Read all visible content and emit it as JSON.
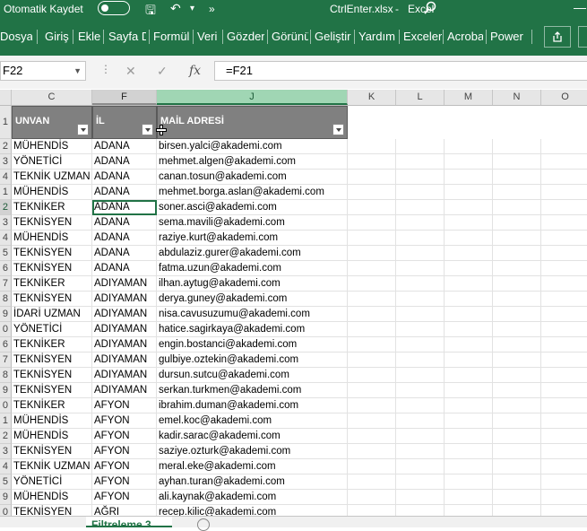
{
  "titlebar": {
    "autosave_label": "Otomatik Kaydet",
    "filename": "CtrlEnter.xlsx",
    "separator": "-",
    "app": "Excel",
    "more": "»"
  },
  "ribbon": {
    "tabs": [
      "Dosya",
      "Giriş",
      "Ekle",
      "Sayfa D",
      "Formül",
      "Veri",
      "Gözder",
      "Görünü",
      "Geliştir",
      "Yardım",
      "Exceler",
      "Acroba",
      "Power"
    ]
  },
  "formula_bar": {
    "name_box": "F22",
    "formula": "=F21",
    "fx": "fx"
  },
  "columns": [
    {
      "label": "C"
    },
    {
      "label": "F"
    },
    {
      "label": "J"
    },
    {
      "label": "K"
    },
    {
      "label": "L"
    },
    {
      "label": "M"
    },
    {
      "label": "N"
    },
    {
      "label": "O"
    }
  ],
  "headers": {
    "row_num": "1",
    "unvan": "UNVAN",
    "il": "İL",
    "mail": "MAİL ADRESİ"
  },
  "rows": [
    {
      "n": "2",
      "unvan": "MÜHENDİS",
      "il": "ADANA",
      "mail": "birsen.yalci@akademi.com"
    },
    {
      "n": "3",
      "unvan": "YÖNETİCİ",
      "il": "ADANA",
      "mail": "mehmet.algen@akademi.com"
    },
    {
      "n": "4",
      "unvan": "TEKNİK UZMAN",
      "il": "ADANA",
      "mail": "canan.tosun@akademi.com"
    },
    {
      "n": "1",
      "unvan": "MÜHENDİS",
      "il": "ADANA",
      "mail": "mehmet.borga.aslan@akademi.com"
    },
    {
      "n": "2",
      "unvan": "TEKNİKER",
      "il": "ADANA",
      "mail": "soner.asci@akademi.com"
    },
    {
      "n": "3",
      "unvan": "TEKNİSYEN",
      "il": "ADANA",
      "mail": "sema.mavili@akademi.com"
    },
    {
      "n": "4",
      "unvan": "MÜHENDİS",
      "il": "ADANA",
      "mail": "raziye.kurt@akademi.com"
    },
    {
      "n": "5",
      "unvan": "TEKNİSYEN",
      "il": "ADANA",
      "mail": "abdulaziz.gurer@akademi.com"
    },
    {
      "n": "6",
      "unvan": "TEKNİSYEN",
      "il": "ADANA",
      "mail": "fatma.uzun@akademi.com"
    },
    {
      "n": "7",
      "unvan": "TEKNİKER",
      "il": "ADIYAMAN",
      "mail": "ilhan.aytug@akademi.com"
    },
    {
      "n": "8",
      "unvan": "TEKNİSYEN",
      "il": "ADIYAMAN",
      "mail": "derya.guney@akademi.com"
    },
    {
      "n": "9",
      "unvan": "İDARİ UZMAN",
      "il": "ADIYAMAN",
      "mail": "nisa.cavusuzumu@akademi.com"
    },
    {
      "n": "0",
      "unvan": "YÖNETİCİ",
      "il": "ADIYAMAN",
      "mail": "hatice.sagirkaya@akademi.com"
    },
    {
      "n": "6",
      "unvan": "TEKNİKER",
      "il": "ADIYAMAN",
      "mail": "engin.bostanci@akademi.com"
    },
    {
      "n": "7",
      "unvan": "TEKNİSYEN",
      "il": "ADIYAMAN",
      "mail": "gulbiye.oztekin@akademi.com"
    },
    {
      "n": "8",
      "unvan": "TEKNİSYEN",
      "il": "ADIYAMAN",
      "mail": "dursun.sutcu@akademi.com"
    },
    {
      "n": "9",
      "unvan": "TEKNİSYEN",
      "il": "ADIYAMAN",
      "mail": "serkan.turkmen@akademi.com"
    },
    {
      "n": "0",
      "unvan": "TEKNİKER",
      "il": "AFYON",
      "mail": "ibrahim.duman@akademi.com"
    },
    {
      "n": "1",
      "unvan": "MÜHENDİS",
      "il": "AFYON",
      "mail": "emel.koc@akademi.com"
    },
    {
      "n": "2",
      "unvan": "MÜHENDİS",
      "il": "AFYON",
      "mail": "kadir.sarac@akademi.com"
    },
    {
      "n": "3",
      "unvan": "TEKNİSYEN",
      "il": "AFYON",
      "mail": "saziye.ozturk@akademi.com"
    },
    {
      "n": "4",
      "unvan": "TEKNİK UZMAN",
      "il": "AFYON",
      "mail": "meral.eke@akademi.com"
    },
    {
      "n": "5",
      "unvan": "YÖNETİCİ",
      "il": "AFYON",
      "mail": "ayhan.turan@akademi.com"
    },
    {
      "n": "9",
      "unvan": "MÜHENDİS",
      "il": "AFYON",
      "mail": "ali.kaynak@akademi.com"
    },
    {
      "n": "0",
      "unvan": "TEKNİSYEN",
      "il": "AĞRI",
      "mail": "recep.kilic@akademi.com"
    }
  ],
  "active_row_index": 4,
  "sheet": {
    "active_tab": "Filtreleme 3"
  },
  "colors": {
    "excel_green": "#217346",
    "header_fill": "#808080",
    "selected_col_header": "#a0d6b4"
  }
}
